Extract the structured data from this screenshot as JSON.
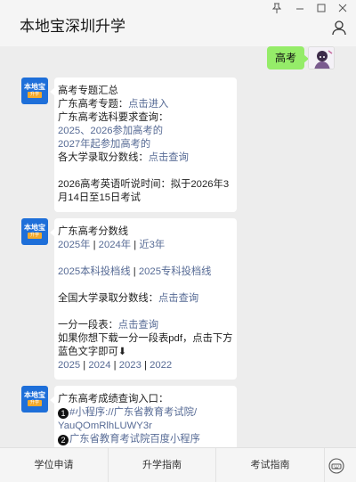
{
  "window": {
    "title": "本地宝深圳升学",
    "controls": [
      "pin-icon",
      "minimize-icon",
      "maximize-icon",
      "close-icon"
    ]
  },
  "sent": {
    "text": "高考"
  },
  "messages": [
    {
      "lines": [
        [
          {
            "t": "高考专题汇总"
          }
        ],
        [
          {
            "t": "广东高考专题："
          },
          {
            "t": "点击进入",
            "link": true
          }
        ],
        [
          {
            "t": "广东高考选科要求查询："
          }
        ],
        [
          {
            "t": "2025、2026参加高考的",
            "link": true
          }
        ],
        [
          {
            "t": "2027年起参加高考的",
            "link": true
          }
        ],
        [
          {
            "t": "各大学录取分数线："
          },
          {
            "t": "点击查询",
            "link": true
          }
        ],
        [],
        [
          {
            "t": "2026高考英语听说时间：拟于2026年3"
          }
        ],
        [
          {
            "t": "月14日至15日考试"
          }
        ]
      ]
    },
    {
      "lines": [
        [
          {
            "t": "广东高考分数线"
          }
        ],
        [
          {
            "t": "2025年",
            "link": true
          },
          {
            "t": " | "
          },
          {
            "t": "2024年",
            "link": true
          },
          {
            "t": " | "
          },
          {
            "t": "近3年",
            "link": true
          }
        ],
        [],
        [
          {
            "t": "2025本科投档线",
            "link": true
          },
          {
            "t": " | "
          },
          {
            "t": "2025专科投档线",
            "link": true
          }
        ],
        [],
        [
          {
            "t": "全国大学录取分数线："
          },
          {
            "t": "点击查询",
            "link": true
          }
        ],
        [],
        [
          {
            "t": "一分一段表："
          },
          {
            "t": "点击查询",
            "link": true
          }
        ],
        [
          {
            "t": "如果你想下载一分一段表pdf，点击下方"
          }
        ],
        [
          {
            "t": "蓝色文字即可⬇"
          }
        ],
        [
          {
            "t": "2025",
            "link": true
          },
          {
            "t": " | "
          },
          {
            "t": "2024",
            "link": true
          },
          {
            "t": " | "
          },
          {
            "t": "2023",
            "link": true
          },
          {
            "t": " | "
          },
          {
            "t": "2022",
            "link": true
          }
        ]
      ]
    },
    {
      "lines": [
        [
          {
            "t": "广东高考成绩查询入口："
          }
        ],
        [
          {
            "num": "1"
          },
          {
            "t": "#小程序://广东省教育考试院/",
            "link": true
          }
        ],
        [
          {
            "t": "YauQOmRlhLUWY3r",
            "link": true
          }
        ],
        [
          {
            "num": "2"
          },
          {
            "t": "广东省教育考试院百度小程序",
            "link": true
          }
        ]
      ]
    }
  ],
  "bot_avatar": {
    "top_text": "本地宝",
    "bottom_text": "升学"
  },
  "menu": {
    "items": [
      "学位申请",
      "升学指南",
      "考试指南"
    ],
    "keyboard_icon": "keyboard-toggle-icon"
  },
  "colors": {
    "link": "#576b95",
    "sent_bubble": "#95ec69",
    "background": "#ededed",
    "bot_avatar": "#1e6fd9"
  }
}
